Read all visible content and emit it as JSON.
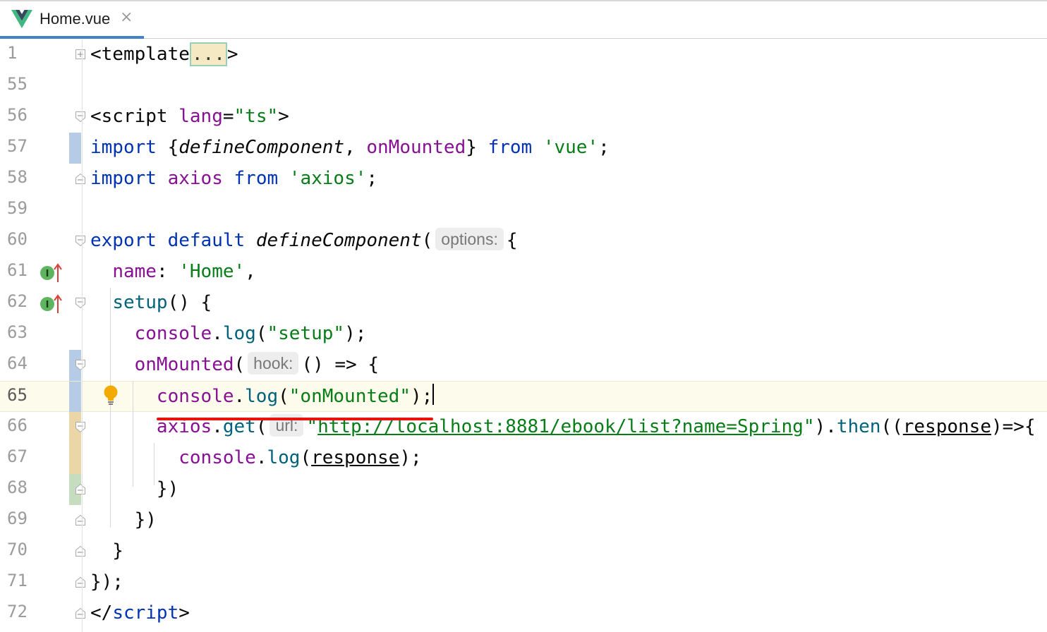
{
  "tab": {
    "title": "Home.vue",
    "close_symbol": "×",
    "logo_icon": "vue-logo-icon"
  },
  "colors": {
    "keyword": "#0033b3",
    "string": "#067d17",
    "property": "#871094",
    "function": "#00627a",
    "tab_underline": "#4083c9",
    "error_underline": "#e8130f"
  },
  "lines": [
    {
      "n": "1",
      "parts": [
        [
          "<template",
          ""
        ],
        [
          "...",
          "folded"
        ],
        [
          ">",
          ""
        ]
      ]
    },
    {
      "n": "55",
      "parts": []
    },
    {
      "n": "56",
      "parts": [
        [
          "<script ",
          ""
        ],
        [
          "lang",
          "prop"
        ],
        [
          "=",
          ""
        ],
        [
          "\"ts\"",
          "str"
        ],
        [
          ">",
          ""
        ]
      ]
    },
    {
      "n": "57",
      "parts": [
        [
          "import",
          "kw"
        ],
        [
          " {",
          ""
        ],
        [
          "defineComponent",
          "it"
        ],
        [
          ", ",
          ""
        ],
        [
          "onMounted",
          "prop"
        ],
        [
          "} ",
          ""
        ],
        [
          "from",
          "kw"
        ],
        [
          " ",
          ""
        ],
        [
          "'vue'",
          "str"
        ],
        [
          ";",
          ""
        ]
      ]
    },
    {
      "n": "58",
      "parts": [
        [
          "import",
          "kw"
        ],
        [
          " ",
          ""
        ],
        [
          "axios",
          "prop"
        ],
        [
          " ",
          ""
        ],
        [
          "from",
          "kw"
        ],
        [
          " ",
          ""
        ],
        [
          "'axios'",
          "str"
        ],
        [
          ";",
          ""
        ]
      ]
    },
    {
      "n": "59",
      "parts": []
    },
    {
      "n": "60",
      "parts": [
        [
          "export",
          "kw"
        ],
        [
          " ",
          ""
        ],
        [
          "default",
          "kw"
        ],
        [
          " ",
          ""
        ],
        [
          "defineComponent",
          "it"
        ],
        [
          "(",
          ""
        ],
        [
          "options:",
          "hint"
        ],
        [
          "{",
          ""
        ]
      ]
    },
    {
      "n": "61",
      "parts": [
        [
          "  ",
          ""
        ],
        [
          "name",
          "prop"
        ],
        [
          ": ",
          ""
        ],
        [
          "'Home'",
          "str"
        ],
        [
          ",",
          ""
        ]
      ]
    },
    {
      "n": "62",
      "parts": [
        [
          "  ",
          ""
        ],
        [
          "setup",
          "fn"
        ],
        [
          "() {",
          ""
        ]
      ]
    },
    {
      "n": "63",
      "parts": [
        [
          "    ",
          ""
        ],
        [
          "console",
          "prop"
        ],
        [
          ".",
          ""
        ],
        [
          "log",
          "fn"
        ],
        [
          "(",
          ""
        ],
        [
          "\"setup\"",
          "str"
        ],
        [
          ");",
          ""
        ]
      ]
    },
    {
      "n": "64",
      "parts": [
        [
          "    ",
          ""
        ],
        [
          "onMounted",
          "prop"
        ],
        [
          "(",
          ""
        ],
        [
          "hook:",
          "hint"
        ],
        [
          "() => {",
          ""
        ]
      ]
    },
    {
      "n": "65",
      "parts": [
        [
          "      ",
          ""
        ],
        [
          "console",
          "prop"
        ],
        [
          ".",
          ""
        ],
        [
          "log",
          "fn"
        ],
        [
          "(",
          ""
        ],
        [
          "\"onMounted\"",
          "str"
        ],
        [
          ");",
          ""
        ],
        [
          "",
          "caret"
        ]
      ]
    },
    {
      "n": "66",
      "parts": [
        [
          "      ",
          ""
        ],
        [
          "axios",
          "prop"
        ],
        [
          ".",
          ""
        ],
        [
          "get",
          "fn"
        ],
        [
          "(",
          ""
        ],
        [
          "url:",
          "hint"
        ],
        [
          "\"",
          "str"
        ],
        [
          "http://localhost:8881/ebook/list?name=Spring",
          "link"
        ],
        [
          "\"",
          "str"
        ],
        [
          ").",
          ""
        ],
        [
          "then",
          "fn"
        ],
        [
          "((",
          ""
        ],
        [
          "response",
          "und"
        ],
        [
          ")=>{",
          ""
        ]
      ]
    },
    {
      "n": "67",
      "parts": [
        [
          "        ",
          ""
        ],
        [
          "console",
          "prop"
        ],
        [
          ".",
          ""
        ],
        [
          "log",
          "fn"
        ],
        [
          "(",
          ""
        ],
        [
          "response",
          "und"
        ],
        [
          ");",
          ""
        ]
      ]
    },
    {
      "n": "68",
      "parts": [
        [
          "      })",
          ""
        ]
      ]
    },
    {
      "n": "69",
      "parts": [
        [
          "    })",
          ""
        ]
      ]
    },
    {
      "n": "70",
      "parts": [
        [
          "  }",
          ""
        ]
      ]
    },
    {
      "n": "71",
      "parts": [
        [
          "});",
          ""
        ]
      ]
    },
    {
      "n": "72",
      "parts": [
        [
          "</",
          ""
        ],
        [
          "script",
          "kw"
        ],
        [
          ">",
          ""
        ]
      ]
    }
  ],
  "gutter_icons": [
    {
      "line": "61",
      "icon": "implements-up-arrow-icon"
    },
    {
      "line": "62",
      "icon": "implements-up-arrow-icon"
    },
    {
      "line": "65",
      "icon": "lightbulb-intention-icon"
    }
  ]
}
